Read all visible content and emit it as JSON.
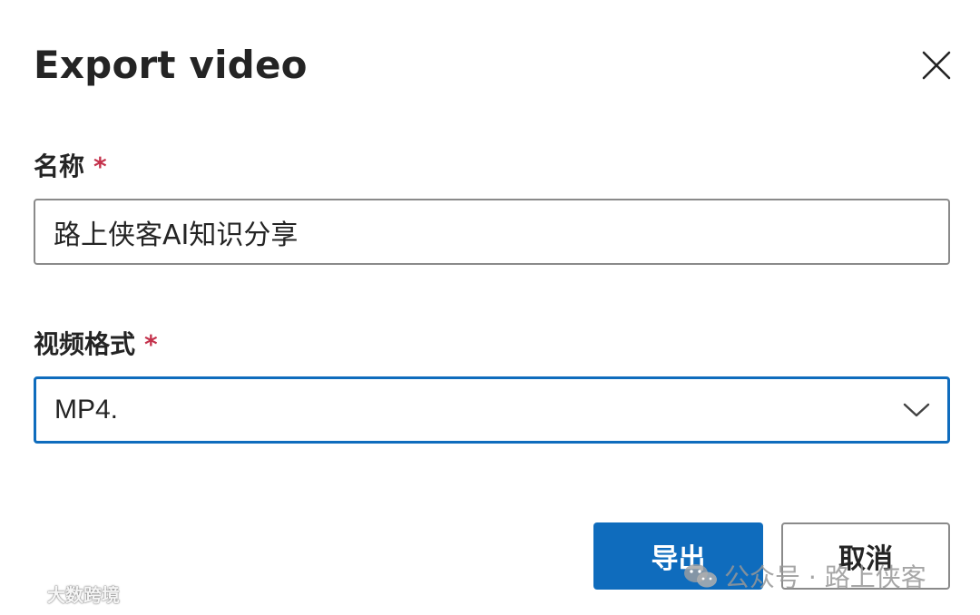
{
  "dialog": {
    "title": "Export video",
    "close_icon": "close-icon"
  },
  "name_field": {
    "label": "名称",
    "required_mark": "*",
    "value": "路上侠客AI知识分享"
  },
  "format_field": {
    "label": "视频格式",
    "required_mark": "*",
    "selected": "MP4.",
    "dropdown_icon": "chevron-down-icon"
  },
  "buttons": {
    "export_label": "导出",
    "cancel_label": "取消"
  },
  "watermarks": {
    "left_text": "大数跨境",
    "right_text": "公众号 · 路上侠客"
  },
  "colors": {
    "accent": "#0f6cbd",
    "required": "#c4314b",
    "text": "#242424",
    "border": "#8a8a8a"
  }
}
